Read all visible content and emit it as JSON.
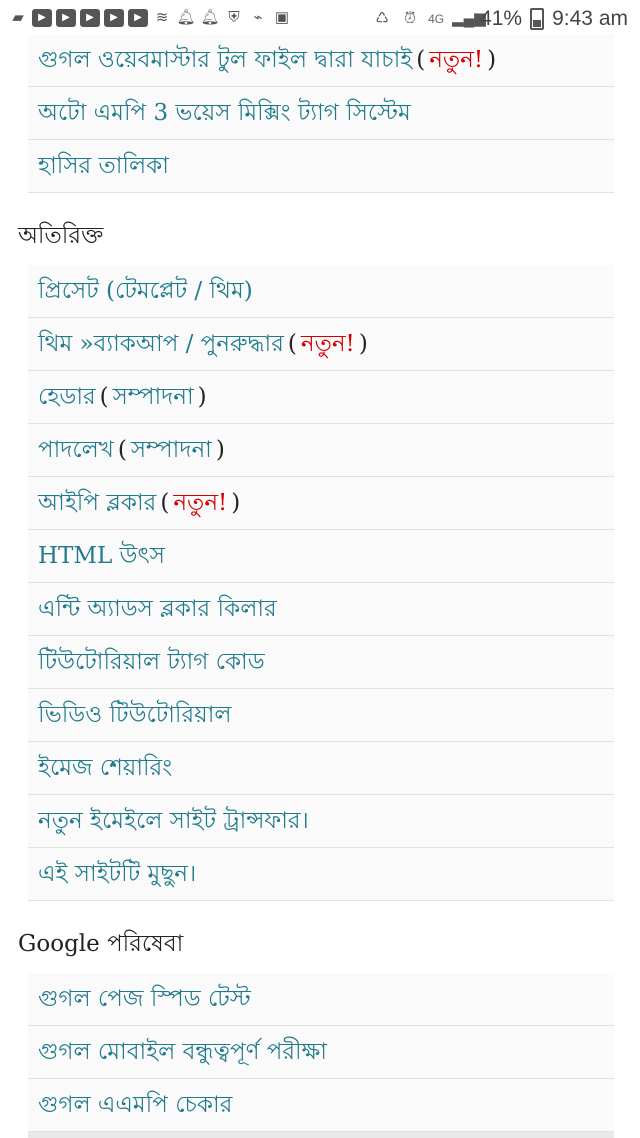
{
  "status_bar": {
    "left_icons": [
      "chat-icon",
      "youtube-icon",
      "youtube-icon",
      "youtube-icon",
      "youtube-icon",
      "youtube-icon",
      "wifi-calling-icon",
      "bell-icon",
      "bell-icon",
      "shield-icon",
      "usb-icon",
      "image-icon"
    ],
    "right": {
      "network": "4G",
      "battery": "41%",
      "time": "9:43 am"
    }
  },
  "top_list": [
    {
      "label": "গুগল ওয়েবমাস্টার টুল ফাইল দ্বারা যাচাই",
      "badge_open": "(",
      "badge": "নতুন!",
      "badge_close": ")"
    },
    {
      "label": "অটো এমপি 3 ভয়েস মিক্সিং ট্যাগ সিস্টেম"
    },
    {
      "label": "হাসির তালিকা"
    }
  ],
  "section_extra": {
    "title": "অতিরিক্ত",
    "items": [
      {
        "label": "প্রিসেট (টেমপ্লেট / থিম)"
      },
      {
        "label": "থিম »ব্যাকআপ / পুনরুদ্ধার",
        "badge_open": "(",
        "badge": "নতুন!",
        "badge_close": ")"
      },
      {
        "label": "হেডার",
        "open": "(",
        "link2": "সম্পাদনা",
        "close": ")"
      },
      {
        "label": "পাদলেখ",
        "open": "(",
        "link2": "সম্পাদনা",
        "close": ")"
      },
      {
        "label": "আইপি ব্লকার",
        "badge_open": "(",
        "badge": "নতুন!",
        "badge_close": ")"
      },
      {
        "label": "HTML উৎস"
      },
      {
        "label": "এন্টি অ্যাডস ব্লকার কিলার"
      },
      {
        "label": "টিউটোরিয়াল ট্যাগ কোড"
      },
      {
        "label": "ভিডিও টিউটোরিয়াল"
      },
      {
        "label": "ইমেজ শেয়ারিং"
      },
      {
        "label": "নতুন ইমেইলে সাইট ট্রান্সফার।"
      },
      {
        "label": "এই সাইটটি মুছুন।"
      }
    ]
  },
  "section_google": {
    "title": "Google পরিষেবা",
    "items": [
      {
        "label": "গুগল পেজ স্পিড টেস্ট"
      },
      {
        "label": "গুগল মোবাইল বন্ধুত্বপূর্ণ পরীক্ষা"
      },
      {
        "label": "গুগল এএমপি চেকার"
      }
    ]
  }
}
